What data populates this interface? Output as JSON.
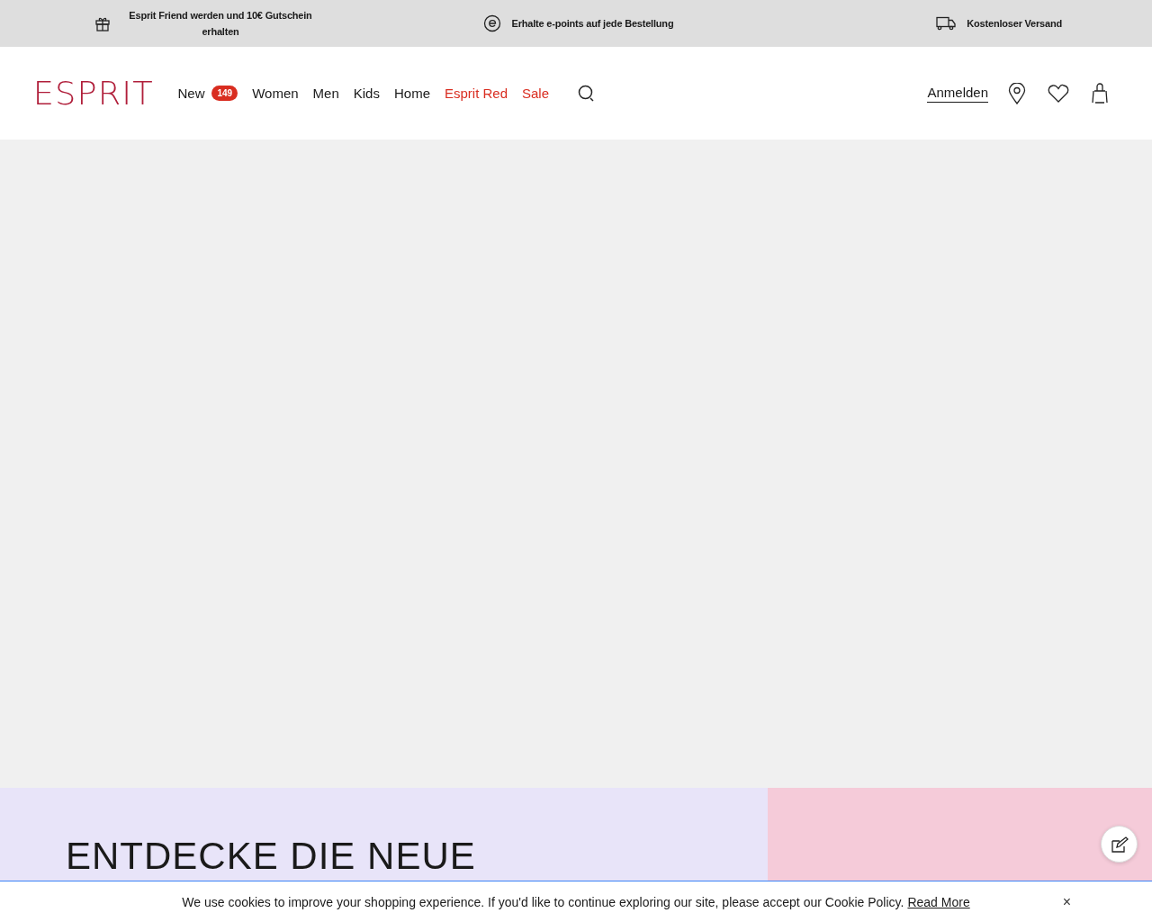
{
  "promo_bar": [
    {
      "kind": "gift",
      "text": "Esprit Friend werden und 10€ Gutschein erhalten"
    },
    {
      "kind": "points",
      "text": "Erhalte e-points auf jede Bestellung"
    },
    {
      "kind": "truck",
      "text": "Kostenloser Versand"
    }
  ],
  "header": {
    "logo": "ESPRIT",
    "nav": [
      {
        "label": "New",
        "kind": "regular",
        "badge": "149"
      },
      {
        "label": "Women",
        "kind": "regular"
      },
      {
        "label": "Men",
        "kind": "regular"
      },
      {
        "label": "Kids",
        "kind": "regular"
      },
      {
        "label": "Home",
        "kind": "regular"
      },
      {
        "label": "Esprit Red",
        "kind": "promo"
      },
      {
        "label": "Sale",
        "kind": "promo"
      }
    ],
    "login": "Anmelden"
  },
  "banner": {
    "headline": "ENTDECKE DIE NEUE"
  },
  "cookie_bar": {
    "text": "We use cookies to improve your shopping experience. If you'd like to continue exploring our site, please accept our Cookie Policy.",
    "link": "Read More",
    "close": "×"
  }
}
